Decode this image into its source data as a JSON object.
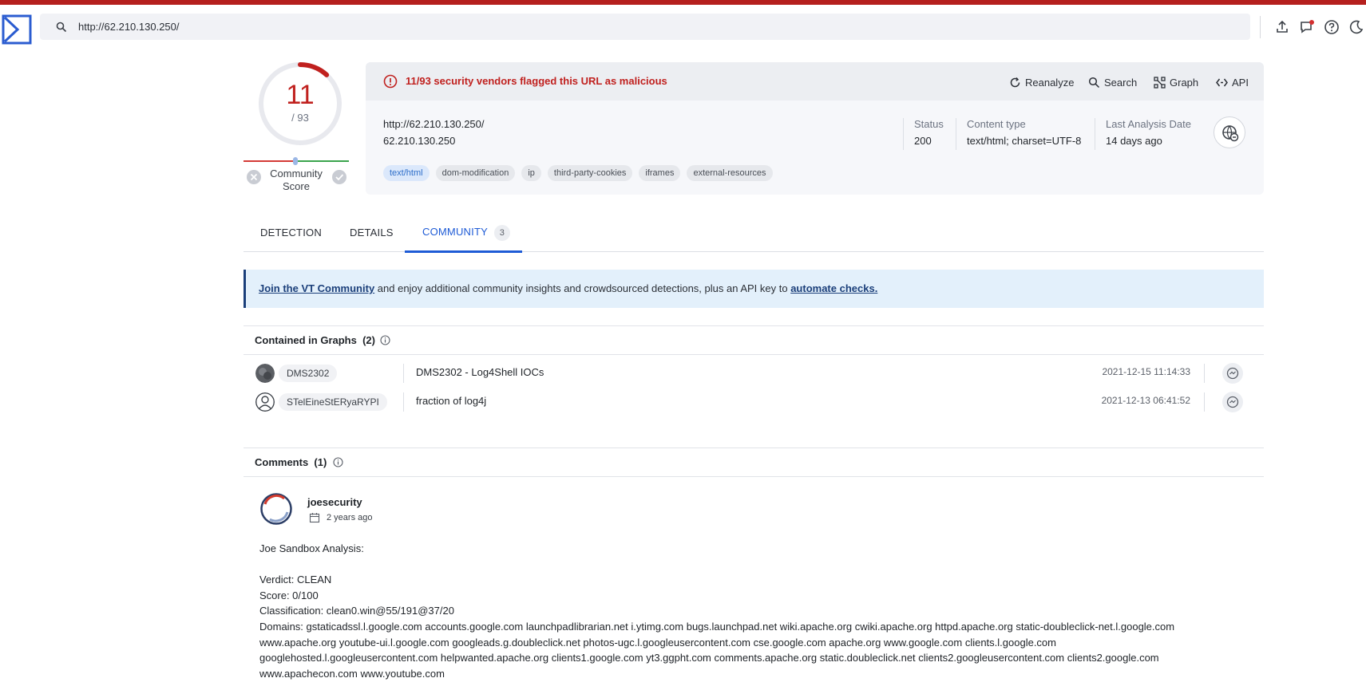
{
  "search": {
    "value": "http://62.210.130.250/"
  },
  "score": {
    "detections": "11",
    "total": "/ 93",
    "detection_fraction": 0.118,
    "community_label": "Community Score"
  },
  "alert": {
    "text": "11/93 security vendors flagged this URL as malicious"
  },
  "actions": {
    "reanalyze": "Reanalyze",
    "search": "Search",
    "graph": "Graph",
    "api": "API"
  },
  "summary": {
    "url": "http://62.210.130.250/",
    "ip": "62.210.130.250",
    "status_label": "Status",
    "status_value": "200",
    "content_type_label": "Content type",
    "content_type_value": "text/html; charset=UTF-8",
    "last_analysis_label": "Last Analysis Date",
    "last_analysis_value": "14 days ago",
    "tags": [
      "text/html",
      "dom-modification",
      "ip",
      "third-party-cookies",
      "iframes",
      "external-resources"
    ]
  },
  "tabs": {
    "detection": "DETECTION",
    "details": "DETAILS",
    "community": "COMMUNITY",
    "community_count": "3"
  },
  "banner": {
    "link1": "Join the VT Community",
    "middle": " and enjoy additional community insights and crowdsourced detections, plus an API key to ",
    "link2": "automate checks."
  },
  "graphs": {
    "title": "Contained in Graphs",
    "count": "(2)",
    "rows": [
      {
        "user": "DMS2302",
        "name": "DMS2302 - Log4Shell IOCs",
        "date": "2021-12-15 11:14:33"
      },
      {
        "user": "STelEineStERyaRYPI",
        "name": "fraction of log4j",
        "date": "2021-12-13 06:41:52"
      }
    ]
  },
  "comments": {
    "title": "Comments",
    "count": "(1)",
    "author": "joesecurity",
    "time": "2 years ago",
    "lines": {
      "l1": "Joe Sandbox Analysis:",
      "l2": "Verdict: CLEAN",
      "l3": "Score: 0/100",
      "l4": "Classification: clean0.win@55/191@37/20",
      "l5": "Domains: gstaticadssl.l.google.com accounts.google.com launchpadlibrarian.net i.ytimg.com bugs.launchpad.net wiki.apache.org cwiki.apache.org httpd.apache.org static-doubleclick-net.l.google.com",
      "l6": "www.apache.org youtube-ui.l.google.com googleads.g.doubleclick.net photos-ugc.l.googleusercontent.com cse.google.com apache.org www.google.com clients.l.google.com",
      "l7": "googlehosted.l.googleusercontent.com helpwanted.apache.org clients1.google.com yt3.ggpht.com comments.apache.org static.doubleclick.net clients2.googleusercontent.com clients2.google.com",
      "l8": "www.apachecon.com www.youtube.com"
    }
  },
  "colors": {
    "accent": "#b5201e",
    "link": "#1e5bd6",
    "banner_bg": "#e3f0fb"
  }
}
